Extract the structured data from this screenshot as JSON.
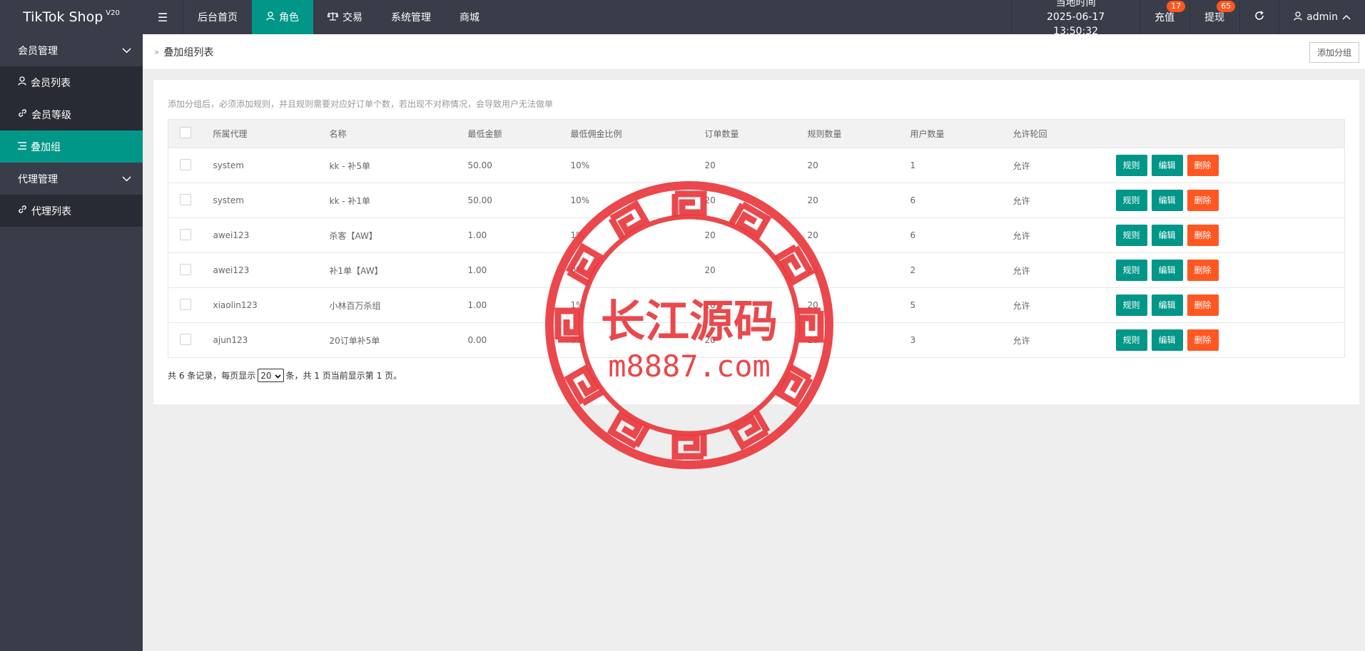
{
  "app": {
    "title": "TikTok Shop",
    "version": "V20"
  },
  "topnav": {
    "items": [
      {
        "label": "后台首页"
      },
      {
        "label": "角色"
      },
      {
        "label": "交易"
      },
      {
        "label": "系统管理"
      },
      {
        "label": "商城"
      }
    ],
    "time_label": "当地时间",
    "time_value": "2025-06-17 13:50:32",
    "recharge_label": "充值",
    "recharge_count": "17",
    "withdraw_label": "提现",
    "withdraw_count": "65",
    "user": "admin"
  },
  "sidebar": {
    "groups": [
      {
        "label": "会员管理",
        "items": [
          {
            "label": "会员列表"
          },
          {
            "label": "会员等级"
          },
          {
            "label": "叠加组"
          }
        ]
      },
      {
        "label": "代理管理",
        "items": [
          {
            "label": "代理列表"
          }
        ]
      }
    ]
  },
  "breadcrumb": {
    "label": "叠加组列表"
  },
  "add_group_label": "添加分组",
  "tip": "添加分组后，必须添加规则，并且规则需要对应好订单个数，若出现不对称情况，会导致用户无法做单",
  "table": {
    "headers": [
      "所属代理",
      "名称",
      "最低金额",
      "最低佣金比例",
      "订单数量",
      "规则数量",
      "用户数量",
      "允许轮回"
    ],
    "rows": [
      {
        "agent": "system",
        "name": "kk - 补5单",
        "min_amount": "50.00",
        "min_rate": "10%",
        "orders": "20",
        "rules": "20",
        "users": "1",
        "loop": "允许"
      },
      {
        "agent": "system",
        "name": "kk - 补1单",
        "min_amount": "50.00",
        "min_rate": "10%",
        "orders": "20",
        "rules": "20",
        "users": "6",
        "loop": "允许"
      },
      {
        "agent": "awei123",
        "name": "杀客【AW】",
        "min_amount": "1.00",
        "min_rate": "1%",
        "orders": "20",
        "rules": "20",
        "users": "6",
        "loop": "允许"
      },
      {
        "agent": "awei123",
        "name": "补1单【AW】",
        "min_amount": "1.00",
        "min_rate": "0%",
        "orders": "20",
        "rules": "20",
        "users": "2",
        "loop": "允许"
      },
      {
        "agent": "xiaolin123",
        "name": "小林百万杀组",
        "min_amount": "1.00",
        "min_rate": "1%",
        "orders": "20",
        "rules": "20",
        "users": "5",
        "loop": "允许"
      },
      {
        "agent": "ajun123",
        "name": "20订单补5单",
        "min_amount": "0.00",
        "min_rate": "0%",
        "orders": "20",
        "rules": "20",
        "users": "3",
        "loop": "允许"
      }
    ],
    "actions": {
      "rule": "规则",
      "edit": "编辑",
      "delete": "删除"
    }
  },
  "pager": {
    "prefix": "共 6 条记录，每页显示",
    "page_size": "20",
    "suffix": "条，共 1 页当前显示第 1 页。"
  },
  "watermark": {
    "line1": "长江源码",
    "line2": "m8887.com"
  },
  "colors": {
    "accent": "#009688",
    "danger": "#ff5722",
    "dark": "#393d49",
    "seal": "#e8383d"
  }
}
